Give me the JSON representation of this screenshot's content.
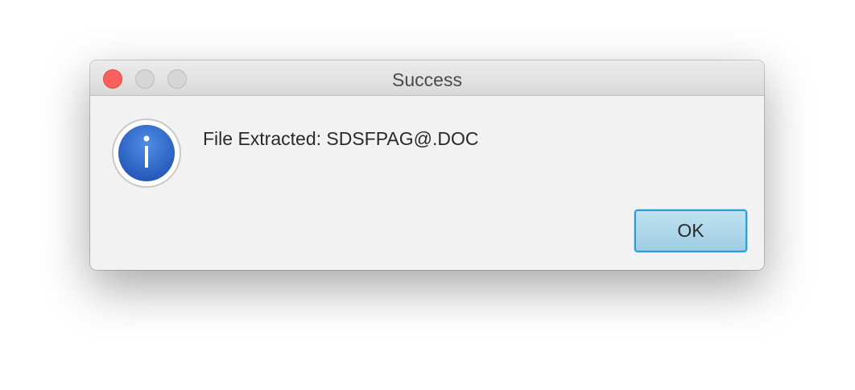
{
  "dialog": {
    "title": "Success",
    "message": "File Extracted: SDSFPAG@.DOC",
    "icon": "info-icon",
    "ok_label": "OK"
  },
  "colors": {
    "close": "#fc605c",
    "inactive_control": "#d6d6d6",
    "icon_blue": "#2f6bd0",
    "button_border": "#2a9fd6"
  }
}
